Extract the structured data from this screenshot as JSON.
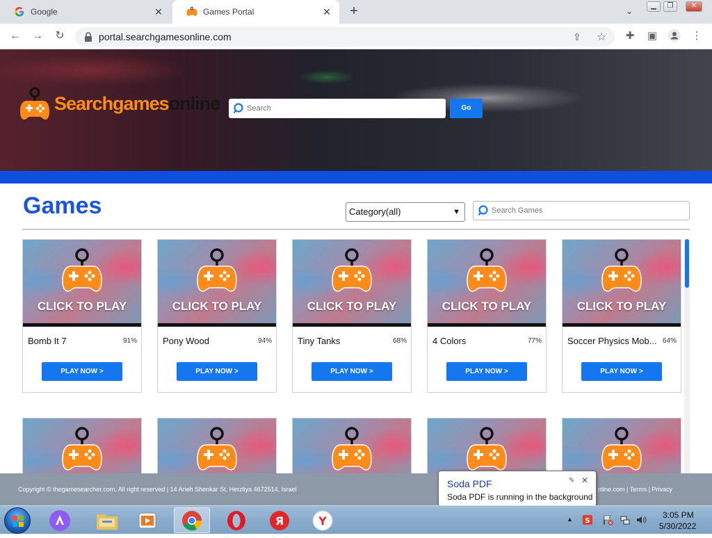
{
  "browser": {
    "tabs": [
      {
        "title": "Google",
        "icon": "google-icon"
      },
      {
        "title": "Games Portal",
        "icon": "gamepad-icon"
      }
    ],
    "url": "portal.searchgamesonline.com"
  },
  "header": {
    "logo_part1": "Searchgames",
    "logo_part2": "online",
    "search_placeholder": "Search",
    "go_label": "Go"
  },
  "games_section": {
    "title": "Games",
    "category_selected": "Category(all)",
    "search_placeholder": "Search Games"
  },
  "games": [
    {
      "name": "Bomb It 7",
      "rating": "91%",
      "overlay": "CLICK TO PLAY",
      "button": "PLAY NOW >"
    },
    {
      "name": "Pony Wood",
      "rating": "94%",
      "overlay": "CLICK TO PLAY",
      "button": "PLAY NOW >"
    },
    {
      "name": "Tiny Tanks",
      "rating": "68%",
      "overlay": "CLICK TO PLAY",
      "button": "PLAY NOW >"
    },
    {
      "name": "4 Colors",
      "rating": "77%",
      "overlay": "CLICK TO PLAY",
      "button": "PLAY NOW >"
    },
    {
      "name": "Soccer Physics Mob...",
      "rating": "64%",
      "overlay": "CLICK TO PLAY",
      "button": "PLAY NOW >"
    }
  ],
  "footer": {
    "copyright": "Copyright © thegamesearcher.com, All right reserved | 14 Arieh Shenkar St, Herzliya 4672514, Israel",
    "right_links": "nline.com | Terms | Privacy"
  },
  "notification": {
    "title": "Soda PDF",
    "message": "Soda PDF is running in the background"
  },
  "taskbar": {
    "time": "3:05 PM",
    "date": "5/30/2022",
    "apps": [
      "alice-icon",
      "file-explorer-icon",
      "media-player-icon",
      "chrome-icon",
      "opera-icon",
      "yandex-browser-icon",
      "yandex-icon"
    ]
  },
  "colors": {
    "accent_blue": "#1577f0",
    "title_blue": "#1a56d6",
    "logo_orange": "#ff8c1a",
    "band_blue": "#0f4fe0"
  }
}
